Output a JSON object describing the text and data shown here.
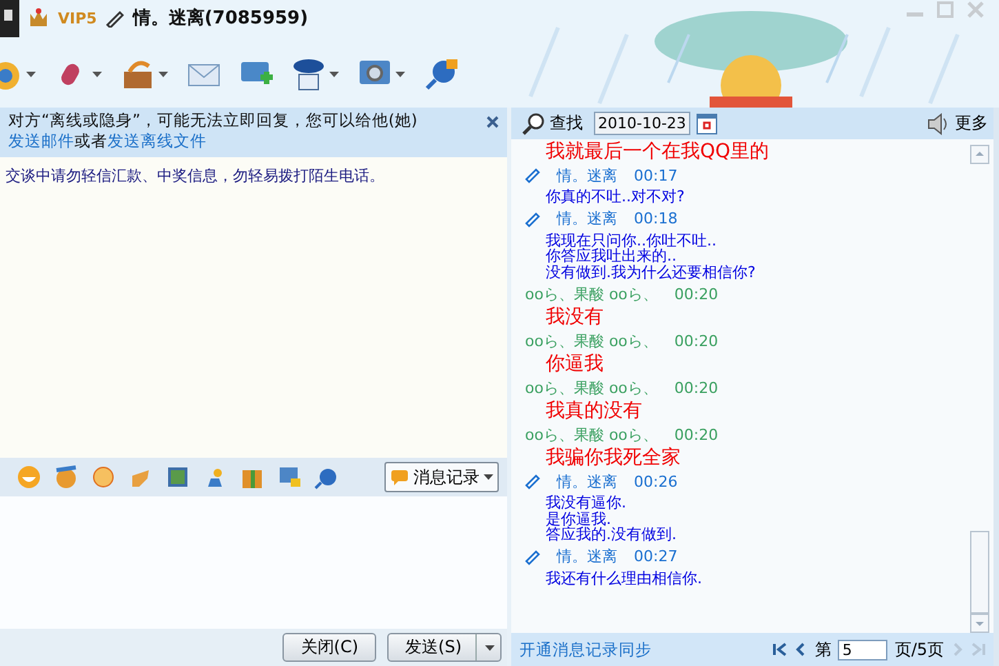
{
  "window": {
    "badge": "VIP5",
    "title": "情。迷离(7085959)"
  },
  "notice": {
    "text": "对方“离线或隐身”，可能无法立即回复，您可以给他(她)",
    "mail_link": "发送邮件",
    "joiner": "或者",
    "file_link": "发送离线文件"
  },
  "warning": "交谈中请勿轻信汇款、中奖信息，勿轻易拨打陌生电话。",
  "history_button": "消息记录",
  "buttons": [
    {
      "label": "关闭(C)",
      "dropdown": false
    },
    {
      "label": "发送(S)",
      "dropdown": true
    }
  ],
  "search": {
    "label": "查找",
    "date": "2010-10-23",
    "more": "更多"
  },
  "messages": [
    {
      "kind": "other",
      "lines": [
        "我就最后一个在我QQ里的"
      ]
    },
    {
      "kind": "me",
      "sender": "情。迷离",
      "time": "00:17",
      "lines": [
        "你真的不吐..对不对?"
      ]
    },
    {
      "kind": "me",
      "sender": "情。迷离",
      "time": "00:18",
      "lines": [
        "我现在只问你..你吐不吐..",
        "你答应我吐出来的..",
        "没有做到.我为什么还要相信你?"
      ]
    },
    {
      "kind": "other",
      "sender": "ooら、果酸 ooら、",
      "time": "00:20",
      "lines": [
        "我没有"
      ]
    },
    {
      "kind": "other",
      "sender": "ooら、果酸 ooら、",
      "time": "00:20",
      "lines": [
        "你逼我"
      ]
    },
    {
      "kind": "other",
      "sender": "ooら、果酸 ooら、",
      "time": "00:20",
      "lines": [
        "我真的没有"
      ]
    },
    {
      "kind": "other",
      "sender": "ooら、果酸 ooら、",
      "time": "00:20",
      "lines": [
        "我骗你我死全家"
      ]
    },
    {
      "kind": "me",
      "sender": "情。迷离",
      "time": "00:26",
      "lines": [
        "我没有逼你.",
        "是你逼我.",
        "答应我的.没有做到."
      ]
    },
    {
      "kind": "me",
      "sender": "情。迷离",
      "time": "00:27",
      "lines": [
        "我还有什么理由相信你."
      ]
    }
  ],
  "history_footer": {
    "sync_link": "开通消息记录同步",
    "page_prefix": "第",
    "page": "5",
    "page_suffix": "页/5页"
  }
}
